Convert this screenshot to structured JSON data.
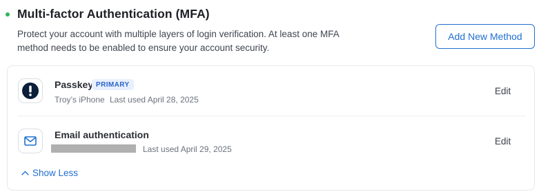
{
  "section": {
    "title": "Multi-factor Authentication (MFA)",
    "description": "Protect your account with multiple layers of login verification. At least one MFA method needs to be enabled to ensure your account security.",
    "add_button_label": "Add New Method",
    "status_color": "#2fb55a",
    "accent_color": "#1f6fd1"
  },
  "methods": [
    {
      "name": "Passkey",
      "badge": "PRIMARY",
      "device": "Troy’s iPhone",
      "last_used": "Last used April 28, 2025",
      "edit_label": "Edit",
      "icon": "passkey-icon"
    },
    {
      "name": "Email authentication",
      "last_used": "Last used April 29, 2025",
      "edit_label": "Edit",
      "icon": "mail-icon"
    }
  ],
  "toggle": {
    "label": "Show Less",
    "icon": "chevron-up-icon"
  }
}
